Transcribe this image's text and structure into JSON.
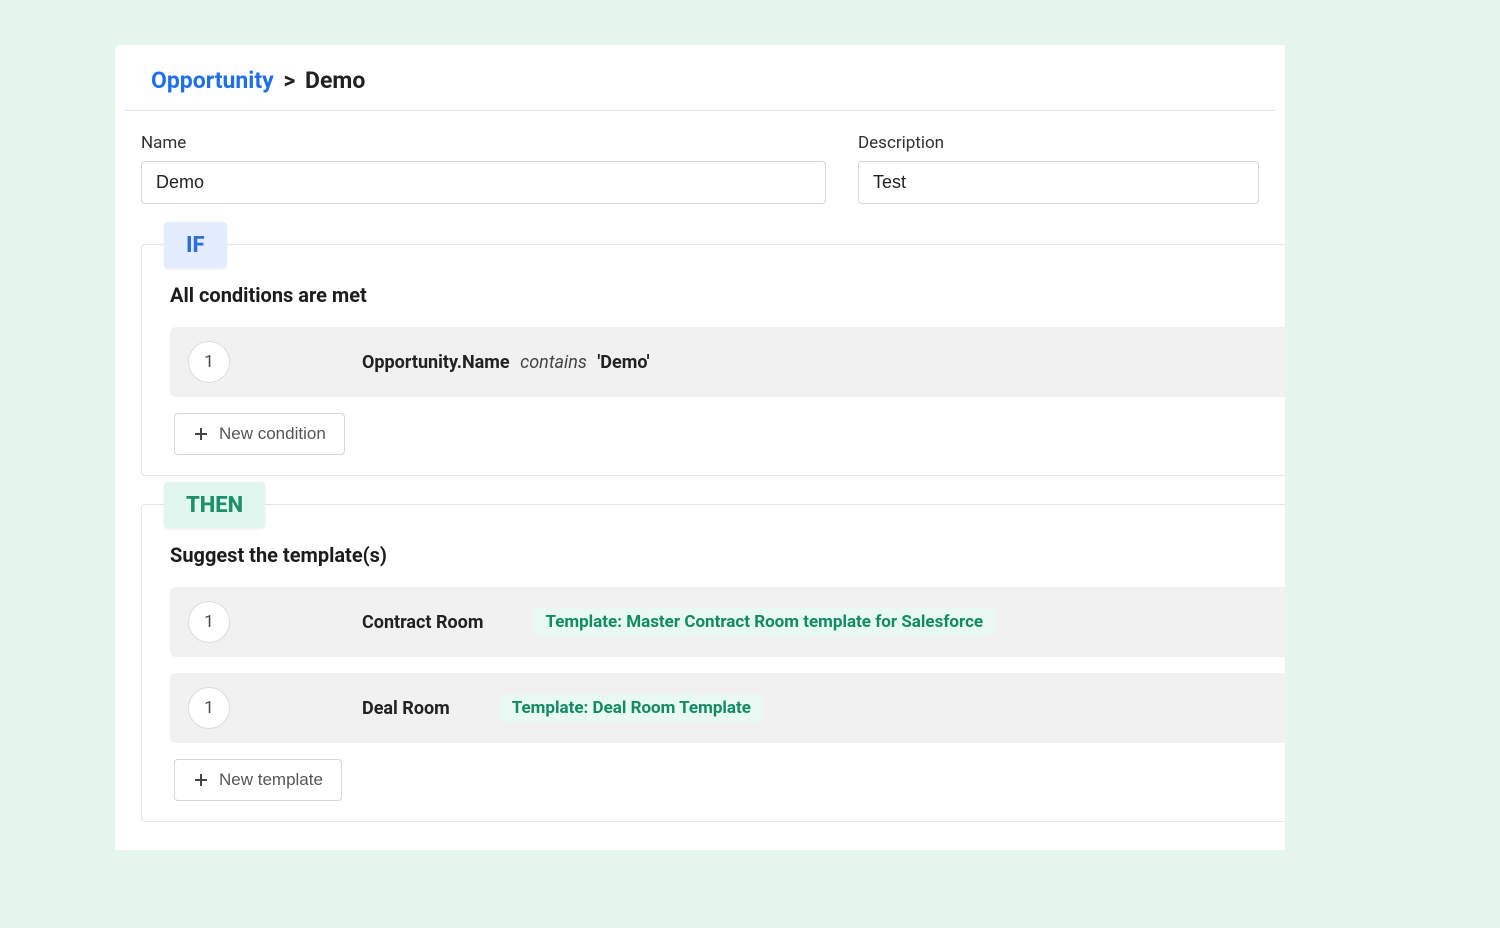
{
  "breadcrumb": {
    "parent": "Opportunity",
    "current": "Demo"
  },
  "form": {
    "name_label": "Name",
    "name_value": "Demo",
    "desc_label": "Description",
    "desc_value": "Test"
  },
  "if_section": {
    "chip": "IF",
    "title": "All conditions are met",
    "conditions": [
      {
        "index": "1",
        "field": "Opportunity.Name",
        "op": "contains",
        "value": "'Demo'"
      }
    ],
    "new_btn": "New condition"
  },
  "then_section": {
    "chip": "THEN",
    "title": "Suggest the template(s)",
    "rows": [
      {
        "index": "1",
        "room": "Contract Room",
        "template": "Template: Master Contract Room template for Salesforce"
      },
      {
        "index": "1",
        "room": "Deal Room",
        "template": "Template: Deal Room Template"
      }
    ],
    "new_btn": "New template"
  }
}
